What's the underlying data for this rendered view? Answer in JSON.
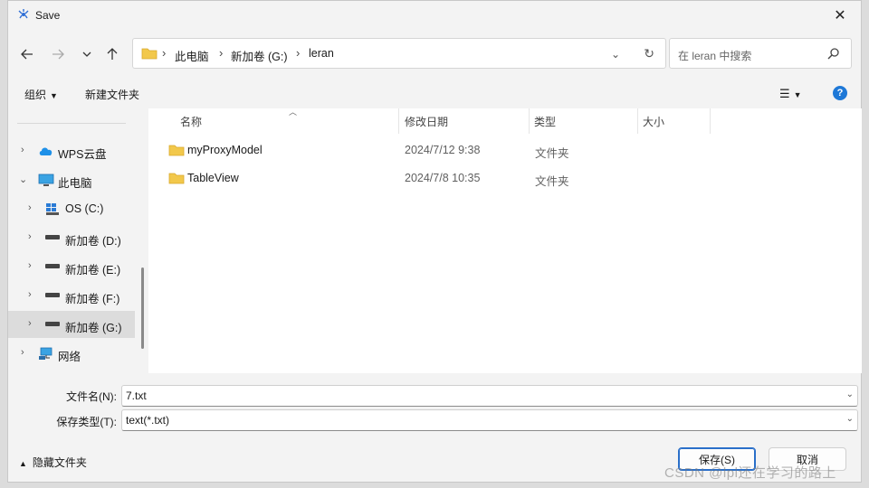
{
  "window": {
    "title": "Save"
  },
  "toolbar": {
    "breadcrumb": [
      "此电脑",
      "新加卷 (G:)",
      "leran"
    ],
    "search_placeholder": "在 leran 中搜索"
  },
  "commands": {
    "organize": "组织",
    "new_folder": "新建文件夹"
  },
  "nav_pane": {
    "items": [
      {
        "label": "WPS云盘",
        "icon": "wps-cloud-icon"
      },
      {
        "label": "此电脑",
        "icon": "computer-icon"
      },
      {
        "label": "OS (C:)",
        "icon": "windows-drive-icon"
      },
      {
        "label": "新加卷 (D:)",
        "icon": "drive-icon"
      },
      {
        "label": "新加卷 (E:)",
        "icon": "drive-icon"
      },
      {
        "label": "新加卷 (F:)",
        "icon": "drive-icon"
      },
      {
        "label": "新加卷 (G:)",
        "icon": "drive-icon"
      },
      {
        "label": "网络",
        "icon": "network-icon"
      }
    ]
  },
  "file_list": {
    "columns": [
      "名称",
      "修改日期",
      "类型",
      "大小"
    ],
    "rows": [
      {
        "name": "myProxyModel",
        "modified": "2024/7/12 9:38",
        "type": "文件夹",
        "size": ""
      },
      {
        "name": "TableView",
        "modified": "2024/7/8 10:35",
        "type": "文件夹",
        "size": ""
      }
    ]
  },
  "save_form": {
    "filename_label": "文件名(N):",
    "filename_value": "7.txt",
    "filetype_label": "保存类型(T):",
    "filetype_value": "text(*.txt)"
  },
  "footer": {
    "hide_folders": "隐藏文件夹",
    "save_button": "保存(S)",
    "cancel_button": "取消"
  },
  "watermark": "CSDN @lpl还在学习的路上",
  "colors": {
    "accent": "#1e78d7",
    "folder": "#f2c84b",
    "selected_bg": "#dcdcdc"
  }
}
